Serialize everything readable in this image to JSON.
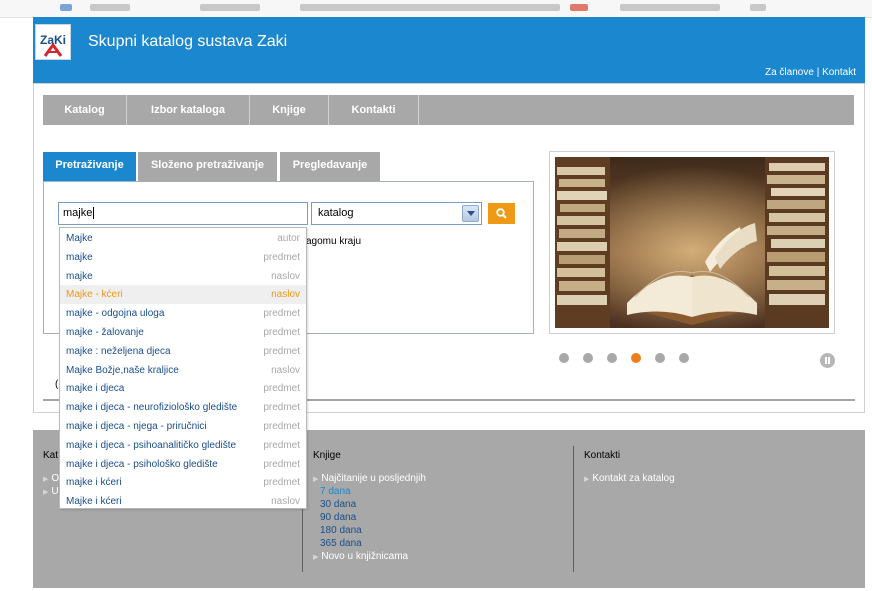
{
  "header": {
    "logo_text": "ZaKi",
    "site_title": "Skupni katalog sustava Zaki",
    "links": [
      "Za članove",
      "Kontakt"
    ],
    "link_separator": "|"
  },
  "nav": {
    "items": [
      "Katalog",
      "Izbor kataloga",
      "Knjige",
      "Kontakti"
    ]
  },
  "search": {
    "tabs": [
      "Pretraživanje",
      "Složeno pretraživanje",
      "Pregledavanje"
    ],
    "active_tab": "Pretraživanje",
    "query": "majke",
    "scope_selected": "katalog",
    "behind_text": "agomu kraju",
    "behind_paren": "("
  },
  "autocomplete": [
    {
      "label": "Majke",
      "type": "autor"
    },
    {
      "label": "majke",
      "type": "predmet"
    },
    {
      "label": "majke",
      "type": "naslov"
    },
    {
      "label": "Majke - kćeri",
      "type": "naslov",
      "highlighted": true
    },
    {
      "label": "majke - odgojna uloga",
      "type": "predmet"
    },
    {
      "label": "majke - žalovanje",
      "type": "predmet"
    },
    {
      "label": "majke : neželjena djeca",
      "type": "predmet"
    },
    {
      "label": "Majke Božje,naše kraljice",
      "type": "naslov"
    },
    {
      "label": "majke i djeca",
      "type": "predmet"
    },
    {
      "label": "majke i djeca - neurofiziološko gledište",
      "type": "predmet"
    },
    {
      "label": "majke i djeca - njega - priručnici",
      "type": "predmet"
    },
    {
      "label": "majke i djeca - psihoanalitičko gledište",
      "type": "predmet"
    },
    {
      "label": "majke i djeca - psihološko gledište",
      "type": "predmet"
    },
    {
      "label": "majke i kćeri",
      "type": "predmet"
    },
    {
      "label": "Majke i kćeri",
      "type": "naslov"
    }
  ],
  "slider": {
    "dot_count": 6,
    "active_dot": 4
  },
  "footer": {
    "col1": {
      "title": "Kat",
      "links": [
        "O",
        "U"
      ]
    },
    "col2": {
      "title": "Knjige",
      "most_read": "Najčitanije u posljednjih",
      "periods": [
        "7 dana",
        "30 dana",
        "90 dana",
        "180 dana",
        "365 dana"
      ],
      "new_in_libraries": "Novo u knjižnicama"
    },
    "col3": {
      "title": "Kontakti",
      "links": [
        "Kontakt za katalog"
      ]
    }
  },
  "colors": {
    "brand_blue": "#1a87cf",
    "nav_gray": "#a8a8a8",
    "accent_orange": "#ee9a17"
  }
}
